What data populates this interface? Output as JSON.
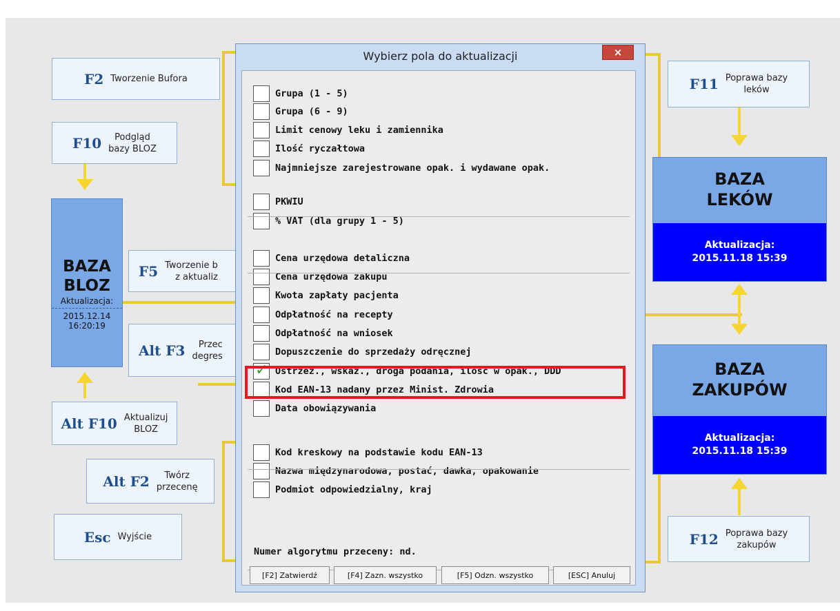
{
  "keys": {
    "f2": {
      "key": "F2",
      "desc": "Tworzenie Bufora"
    },
    "f10": {
      "key": "F10",
      "desc": "Podgląd\nbazy BLOZ"
    },
    "f5": {
      "key": "F5",
      "desc": "Tworzenie b\nz aktualiz"
    },
    "altf3": {
      "key": "Alt F3",
      "desc": "Przec\ndegres"
    },
    "altf10": {
      "key": "Alt F10",
      "desc": "Aktualizuj\nBLOZ"
    },
    "altf2": {
      "key": "Alt F2",
      "desc": "Twórz\nprzecenę"
    },
    "esc": {
      "key": "Esc",
      "desc": "Wyjście"
    },
    "f11": {
      "key": "F11",
      "desc": "Poprawa bazy\nleków"
    },
    "f12": {
      "key": "F12",
      "desc": "Poprawa bazy\nzakupów"
    }
  },
  "bloz": {
    "title": "BAZA\nBLOZ",
    "update_label": "Aktualizacja:",
    "date": "2015.12.14",
    "time": "16:20:19"
  },
  "leki": {
    "title": "BAZA\nLEKÓW",
    "update_label": "Aktualizacja:",
    "datetime": "2015.11.18 15:39"
  },
  "zakupy": {
    "title": "BAZA\nZAKUPÓW",
    "update_label": "Aktualizacja:",
    "datetime": "2015.11.18 15:39"
  },
  "dialog": {
    "title": "Wybierz pola do aktualizacji",
    "close": "×",
    "items": [
      {
        "label": "Grupa (1 - 5)",
        "checked": false
      },
      {
        "label": "Grupa (6 - 9)",
        "checked": false
      },
      {
        "label": "Limit cenowy leku i zamiennika",
        "checked": false
      },
      {
        "label": "Ilość ryczałtowa",
        "checked": false
      },
      {
        "label": "Najmniejsze zarejestrowane opak. i wydawane opak.",
        "checked": false
      },
      {
        "label": "PKWIU",
        "checked": false
      },
      {
        "label": "% VAT (dla grupy 1 - 5)",
        "checked": false
      },
      {
        "label": "Cena urzędowa detaliczna",
        "checked": false
      },
      {
        "label": "Cena urzędowa zakupu",
        "checked": false
      },
      {
        "label": "Kwota zapłaty pacjenta",
        "checked": false
      },
      {
        "label": "Odpłatność na recepty",
        "checked": false
      },
      {
        "label": "Odpłatność na wniosek",
        "checked": false
      },
      {
        "label": "Dopuszczenie do sprzedaży odręcznej",
        "checked": false
      },
      {
        "label": "Ostrzeż., wskaź., droga podania, ilość w opak., DDD",
        "checked": true
      },
      {
        "label": "Kod EAN-13 nadany przez Minist. Zdrowia",
        "checked": false
      },
      {
        "label": "Data obowiązywania",
        "checked": false
      },
      {
        "label": "Kod kreskowy na podstawie kodu EAN-13",
        "checked": false
      },
      {
        "label": "Nazwa międzynarodowa, postać, dawka, opakowanie",
        "checked": false
      },
      {
        "label": "Podmiot odpowiedzialny, kraj",
        "checked": false
      }
    ],
    "algo": "Numer algorytmu przeceny: nd.",
    "buttons": {
      "confirm": "[F2] Zatwierdź",
      "select_all": "[F4] Zazn. wszystko",
      "deselect_all": "[F5] Odzn. wszystko",
      "cancel": "[ESC] Anuluj"
    }
  }
}
